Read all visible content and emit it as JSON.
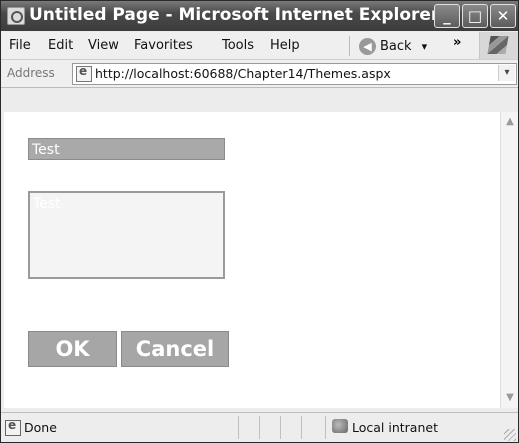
{
  "window": {
    "title": "Untitled Page - Microsoft Internet Explorer"
  },
  "title_buttons": {
    "minimize": "_",
    "maximize": "□",
    "close": "✕"
  },
  "menu": {
    "items": [
      {
        "label": "File"
      },
      {
        "label": "Edit"
      },
      {
        "label": "View"
      },
      {
        "label": "Favorites"
      },
      {
        "label": "Tools"
      },
      {
        "label": "Help"
      }
    ],
    "back_label": "Back",
    "back_icon": "◀",
    "dropdown_glyph": "▾",
    "chevron": "»"
  },
  "address": {
    "label": "Address",
    "url": "http://localhost:60688/Chapter14/Themes.aspx",
    "dropdown_glyph": "▾"
  },
  "content": {
    "textbox_value": "Test",
    "textarea_value": "Test",
    "ok_label": "OK",
    "cancel_label": "Cancel"
  },
  "scrollbar": {
    "up_glyph": "▲",
    "down_glyph": "▼"
  },
  "status": {
    "text": "Done",
    "zone": "Local intranet"
  }
}
